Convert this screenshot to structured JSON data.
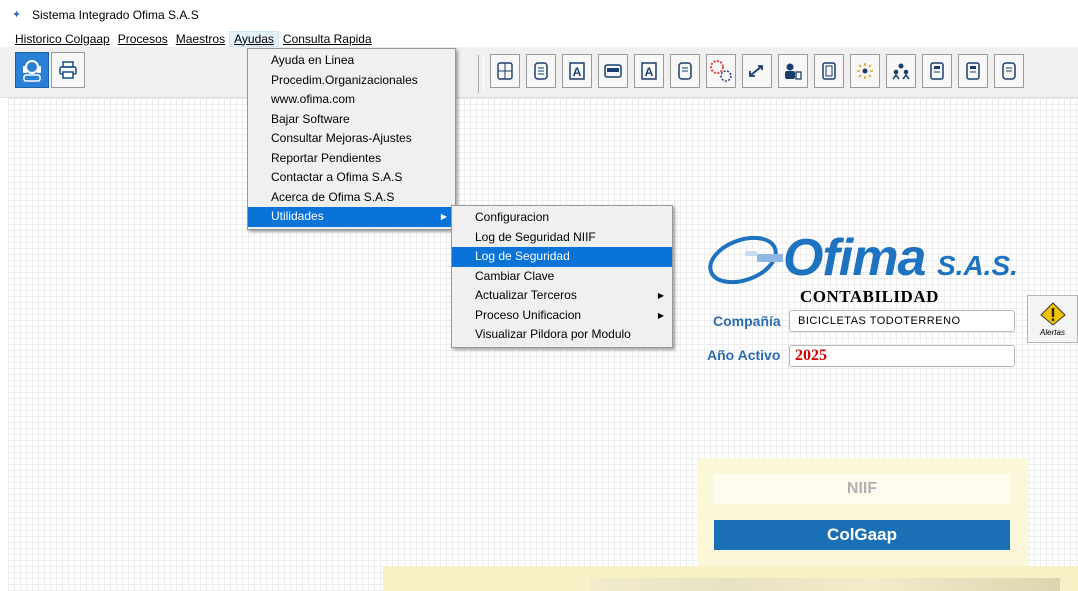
{
  "window": {
    "title": "Sistema Integrado Ofima S.A.S"
  },
  "menubar": {
    "items": [
      {
        "label": "Historico Colgaap"
      },
      {
        "label": "Procesos"
      },
      {
        "label": "Maestros"
      },
      {
        "label": "Ayudas"
      },
      {
        "label": "Consulta Rapida"
      }
    ]
  },
  "toolbar": {
    "left": [
      {
        "icon": "support-headset-icon"
      },
      {
        "icon": "printer-icon"
      }
    ],
    "right": [
      {
        "icon": "calculator-icon"
      },
      {
        "icon": "document-icon"
      },
      {
        "icon": "text-a-icon"
      },
      {
        "icon": "xlsx-export-icon"
      },
      {
        "icon": "text-a-icon"
      },
      {
        "icon": "document-icon"
      },
      {
        "icon": "settings-gears-icon"
      },
      {
        "icon": "exchange-arrows-icon"
      },
      {
        "icon": "user-database-icon"
      },
      {
        "icon": "notebook-icon"
      },
      {
        "icon": "sparkle-icon"
      },
      {
        "icon": "users-group-icon"
      },
      {
        "icon": "report-icon"
      },
      {
        "icon": "report-icon"
      },
      {
        "icon": "document-icon"
      }
    ]
  },
  "ayudas_menu": {
    "items": [
      {
        "label": "Ayuda en Linea"
      },
      {
        "label": "Procedim.Organizacionales"
      },
      {
        "label": "www.ofima.com"
      },
      {
        "label": "Bajar Software"
      },
      {
        "label": "Consultar Mejoras-Ajustes"
      },
      {
        "label": "Reportar Pendientes"
      },
      {
        "label": "Contactar a Ofima S.A.S"
      },
      {
        "label": "Acerca de Ofima S.A.S"
      },
      {
        "label": "Utilidades",
        "has_submenu": true,
        "selected": true
      }
    ]
  },
  "utilidades_menu": {
    "items": [
      {
        "label": "Configuracion"
      },
      {
        "label": "Log de Seguridad NIIF"
      },
      {
        "label": "Log de Seguridad",
        "selected": true
      },
      {
        "label": "Cambiar Clave"
      },
      {
        "label": "Actualizar Terceros",
        "has_submenu": true
      },
      {
        "label": "Proceso Unificacion",
        "has_submenu": true
      },
      {
        "label": "Visualizar Pildora por Modulo"
      }
    ]
  },
  "brand": {
    "name": "Ofima",
    "suffix": "S.A.S."
  },
  "main": {
    "module": "CONTABILIDAD",
    "company_label": "Compañía",
    "company_value": "BICICLETAS TODOTERRENO",
    "year_label": "Año Activo",
    "year_value": "2025",
    "alerts_label": "Alertas",
    "mode_niif": "NIIF",
    "mode_colgaap": "ColGaap"
  },
  "colors": {
    "accent": "#0a73d8",
    "brand_blue": "#1d73c0",
    "label_blue": "#2b6cb0",
    "year_red": "#d40000",
    "panel_yellow": "#fbf8d9"
  }
}
